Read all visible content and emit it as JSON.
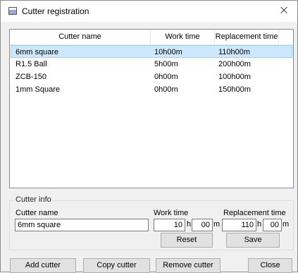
{
  "window": {
    "title": "Cutter registration",
    "close_glyph": "×"
  },
  "list": {
    "columns": [
      "Cutter name",
      "Work time",
      "Replacement time"
    ],
    "rows": [
      {
        "name": "6mm square",
        "work": "10h00m",
        "replacement": "110h00m",
        "selected": true
      },
      {
        "name": "R1.5 Ball",
        "work": "5h00m",
        "replacement": "200h00m"
      },
      {
        "name": "ZCB-150",
        "work": "0h00m",
        "replacement": "100h00m"
      },
      {
        "name": "1mm Square",
        "work": "0h00m",
        "replacement": "150h00m"
      }
    ]
  },
  "cutter_info": {
    "legend": "Cutter info",
    "name_label": "Cutter name",
    "name_value": "6mm square",
    "work_label": "Work time",
    "work_hours": "10",
    "work_minutes": "00",
    "replacement_label": "Replacement time",
    "replacement_hours": "110",
    "replacement_minutes": "00",
    "h_unit": "h",
    "m_unit": "m",
    "reset_label": "Reset",
    "save_label": "Save"
  },
  "buttons": {
    "add": "Add cutter",
    "copy": "Copy cutter",
    "remove": "Remove cutter",
    "close": "Close"
  },
  "colors": {
    "selection": "#cce8ff",
    "selection_border": "#99d1ff"
  },
  "icons": {
    "app": "window-icon",
    "close": "close-icon"
  }
}
